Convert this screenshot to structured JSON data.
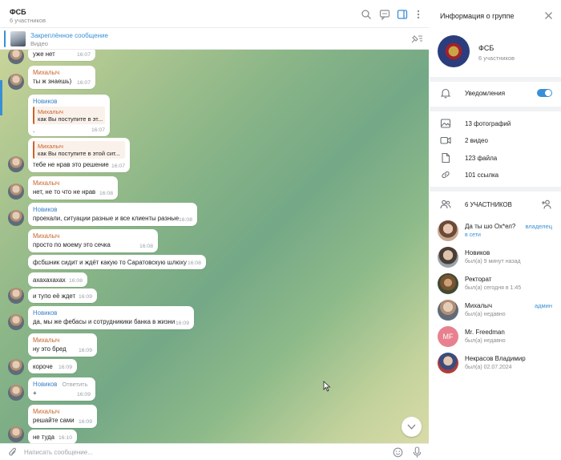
{
  "header": {
    "title": "ФСБ",
    "subtitle": "6 участников",
    "icons": [
      "search-icon",
      "chat-icon",
      "side-panel-icon",
      "more-icon"
    ]
  },
  "pinned": {
    "title": "Закреплённое сообщение",
    "text": "Видео",
    "icon": "pin-list-icon"
  },
  "messages": [
    {
      "sender": "",
      "text": "уже нет",
      "time": "16:07"
    },
    {
      "sender": "Михалыч",
      "text": "ты ж знаешь)",
      "time": "16:07"
    },
    {
      "sender": "Новиков",
      "quote_name": "Михалыч",
      "quote_text": "как Вы поступите в эт...",
      "text": ".",
      "time": "16:07"
    },
    {
      "sender": "",
      "quote_name": "Михалыч",
      "quote_text": "как Вы поступите в этой сит...",
      "text": "тебе не нрав это решение",
      "time": "16:07"
    },
    {
      "sender": "Михалыч",
      "text": "нет, не  то что не нрав",
      "time": "16:08"
    },
    {
      "sender": "Новиков",
      "text": "проехали, ситуации разные и все клиенты разные",
      "time": "16:08"
    },
    {
      "sender": "Михалыч",
      "text": "просто по моему это сечка",
      "time": "16:08"
    },
    {
      "sender": "",
      "text": "фсбшник сидит и ждёт какую то Саратовскую шлюху",
      "time": "16:08"
    },
    {
      "sender": "",
      "text": "ахахахахах",
      "time": "16:08"
    },
    {
      "sender": "",
      "text": "и тупо её ждет",
      "time": "16:09"
    },
    {
      "sender": "Новиков",
      "text": "да, мы же фебасы и сотрудникики банка в жизни",
      "time": "16:09"
    },
    {
      "sender": "Михалыч",
      "text": "ну это бред",
      "time": "16:09"
    },
    {
      "sender": "",
      "text": "короче",
      "time": "16:09"
    },
    {
      "sender": "Новиков",
      "reply_label": "Ответить",
      "text": "+",
      "time": "16:09"
    },
    {
      "sender": "Михалыч",
      "text": "решайте сами",
      "time": "16:09"
    },
    {
      "sender": "",
      "text": "не туда",
      "time": "16:10"
    }
  ],
  "composer": {
    "placeholder": "Написать сообщение..."
  },
  "info": {
    "title": "Информация о группе",
    "group_name": "ФСБ",
    "group_sub": "6 участников",
    "notifications_label": "Уведомления",
    "notifications_on": true,
    "media": [
      {
        "icon": "photo-icon",
        "label": "13 фотографий"
      },
      {
        "icon": "video-icon",
        "label": "2 видео"
      },
      {
        "icon": "file-icon",
        "label": "123 файла"
      },
      {
        "icon": "link-icon",
        "label": "101 ссылка"
      }
    ],
    "members_header": "6 УЧАСТНИКОВ",
    "members": [
      {
        "name": "Да ты шо Ох*ел?",
        "status": "в сети",
        "online": true,
        "role": "владелец"
      },
      {
        "name": "Новиков",
        "status": "был(а) 9 минут назад",
        "online": false,
        "role": ""
      },
      {
        "name": "Ректорат",
        "status": "был(а) сегодня в 1:45",
        "online": false,
        "role": ""
      },
      {
        "name": "Михалыч",
        "status": "был(а) недавно",
        "online": false,
        "role": "админ"
      },
      {
        "name": "Mr. Freedman",
        "status": "был(а) недавно",
        "online": false,
        "role": "",
        "initials": "MF"
      },
      {
        "name": "Некрасов Владимир",
        "status": "был(а) 02.07.2024",
        "online": false,
        "role": ""
      }
    ]
  },
  "colors": {
    "accent": "#3a8fd4",
    "mihalych": "#c8642c",
    "novikov": "#3a7fc4"
  }
}
